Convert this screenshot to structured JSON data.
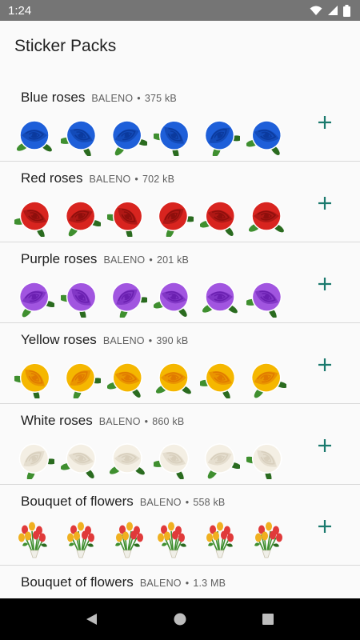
{
  "status": {
    "time": "1:24",
    "icons": [
      "wifi-icon",
      "cellular-signal-icon",
      "battery-icon"
    ]
  },
  "app": {
    "title": "Sticker Packs"
  },
  "packs": [
    {
      "name": "Blue roses",
      "publisher": "BALENO",
      "size": "375 kB",
      "petal": "#1e5fd9",
      "petal_dark": "#0b3a9e"
    },
    {
      "name": "Red roses",
      "publisher": "BALENO",
      "size": "702 kB",
      "petal": "#d8241f",
      "petal_dark": "#8e0f0c"
    },
    {
      "name": "Purple roses",
      "publisher": "BALENO",
      "size": "201 kB",
      "petal": "#a155e0",
      "petal_dark": "#6a1fb0"
    },
    {
      "name": "Yellow roses",
      "publisher": "BALENO",
      "size": "390 kB",
      "petal": "#f5b700",
      "petal_dark": "#e07a00"
    },
    {
      "name": "White roses",
      "publisher": "BALENO",
      "size": "860 kB",
      "petal": "#f4efe4",
      "petal_dark": "#d8cfbd"
    },
    {
      "name": "Bouquet of flowers",
      "publisher": "BALENO",
      "size": "558 kB",
      "petal": "#e03a3a",
      "petal_dark": "#f0b020"
    },
    {
      "name": "Bouquet of flowers",
      "publisher": "BALENO",
      "size": "1.3 MB",
      "petal": "#e03a3a",
      "petal_dark": "#f0b020"
    }
  ],
  "colors": {
    "accent": "#1b7a6e",
    "leaf": "#3f8f2f",
    "leaf_dark": "#2a6b1f"
  },
  "nav": {
    "icons": [
      "back-icon",
      "home-icon",
      "recents-icon"
    ]
  }
}
